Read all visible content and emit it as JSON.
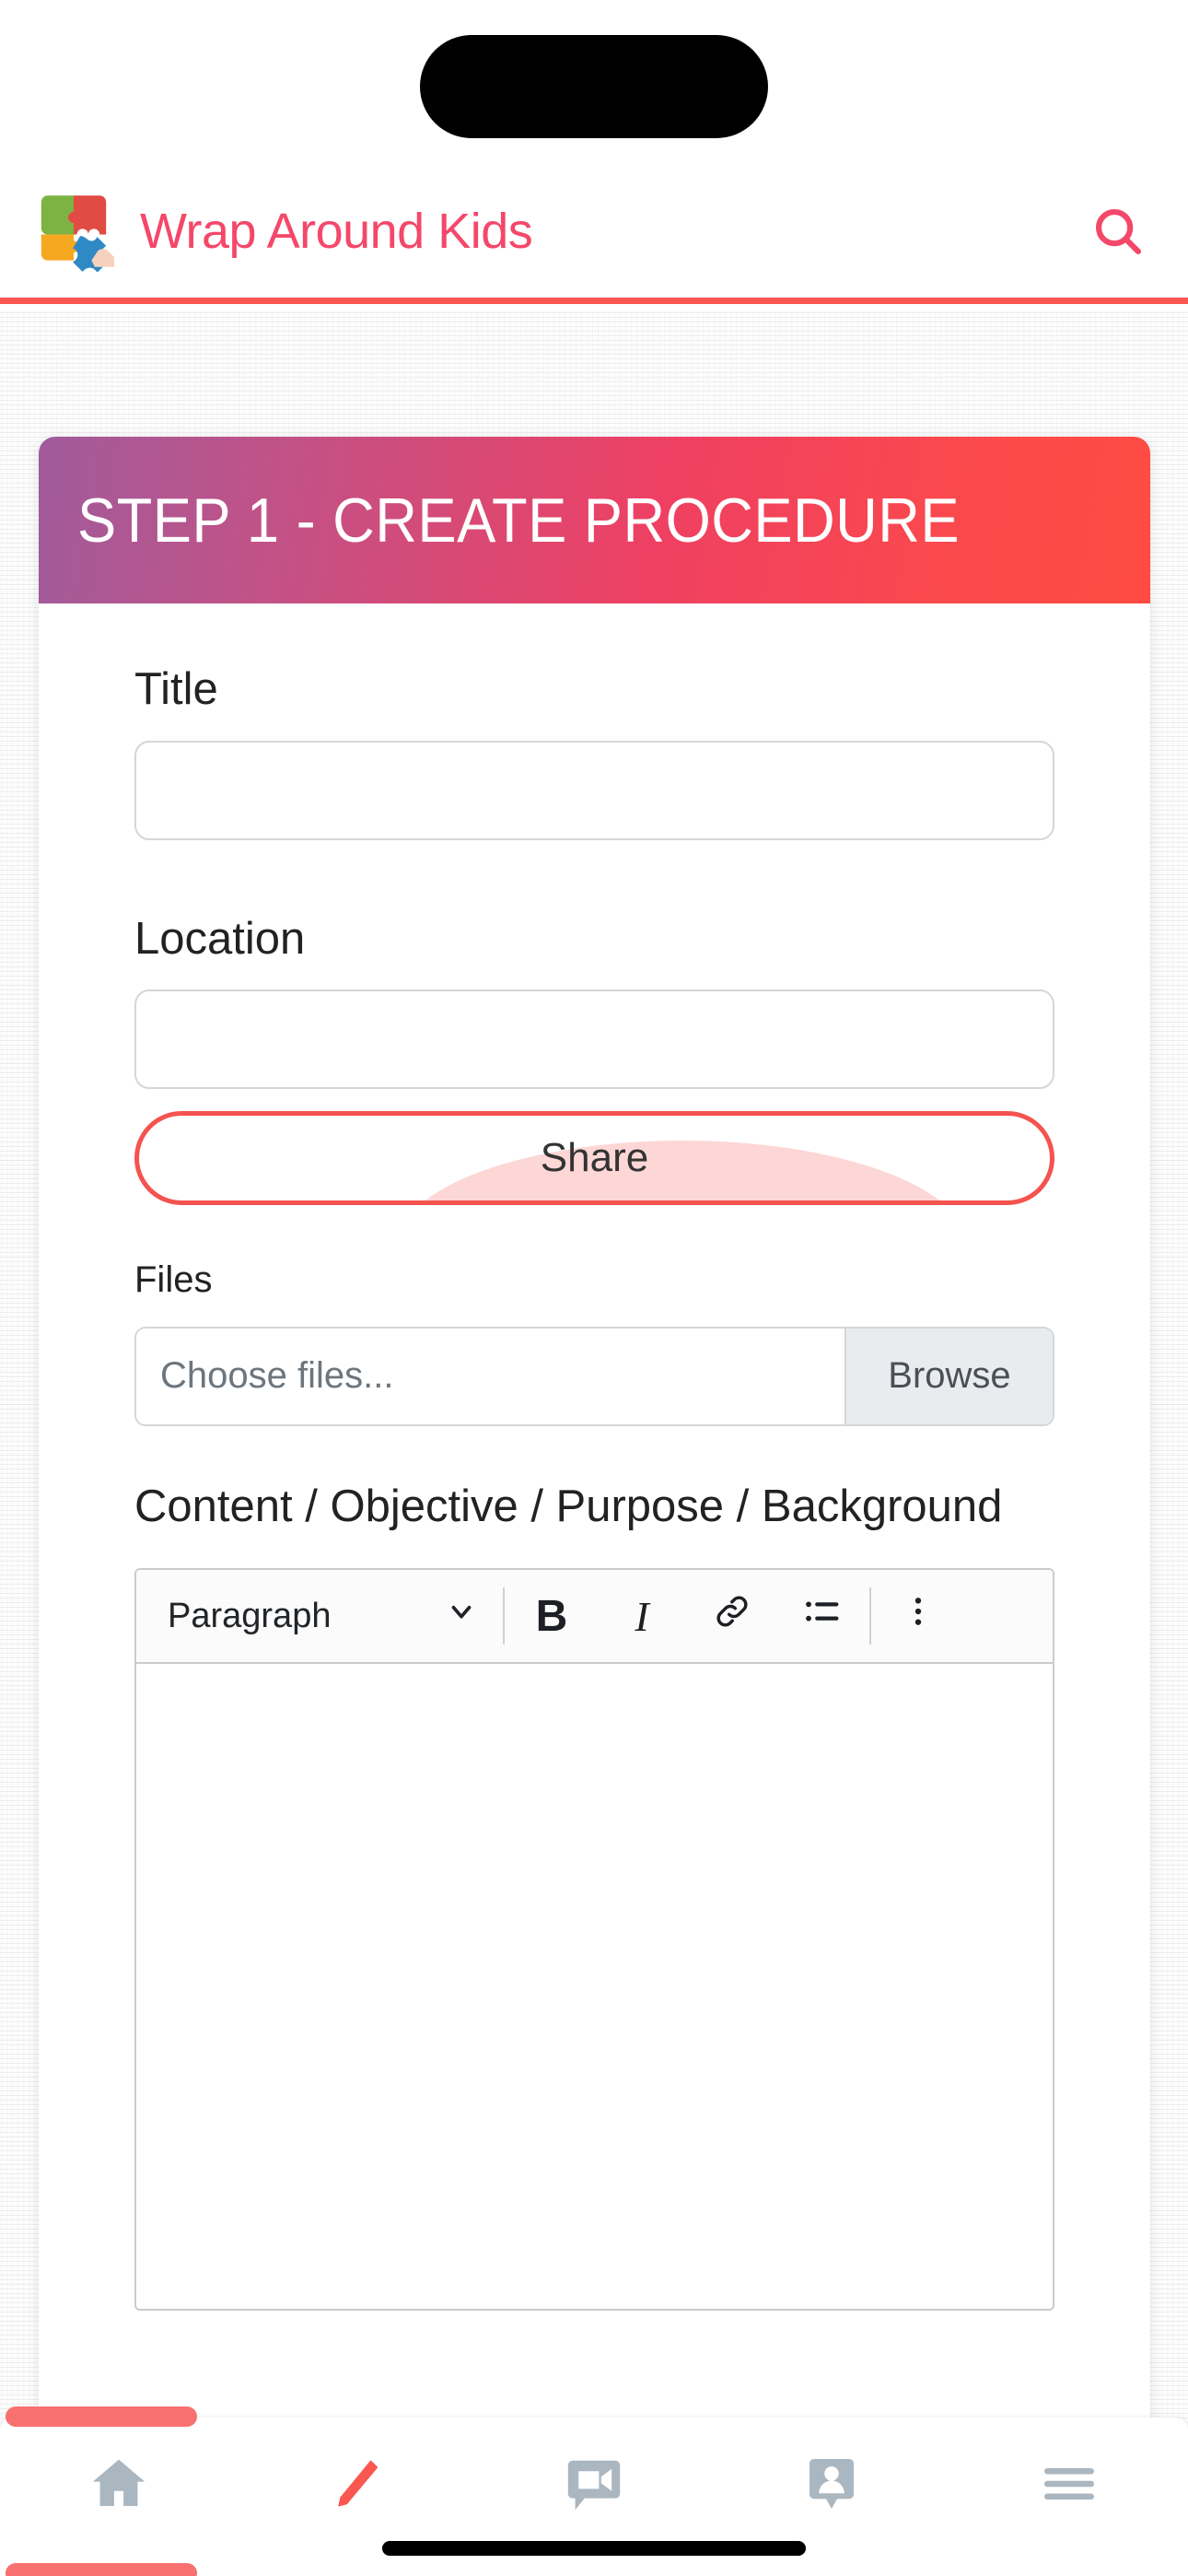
{
  "app": {
    "brand_title": "Wrap Around Kids",
    "brand_color": "#f4486a",
    "accent_color": "#f9574f",
    "logo_icon": "puzzle-hand-logo",
    "search_icon": "search-icon"
  },
  "card": {
    "header_title": "STEP 1 - CREATE PROCEDURE",
    "header_gradient_from": "#a05b9b",
    "header_gradient_to": "#ff4b42"
  },
  "form": {
    "title_label": "Title",
    "title_value": "",
    "title_placeholder": "",
    "location_label": "Location",
    "location_value": "",
    "location_placeholder": "",
    "share_label": "Share",
    "files_label": "Files",
    "files_placeholder": "Choose files...",
    "browse_label": "Browse",
    "content_label": "Content / Objective / Purpose / Background"
  },
  "editor": {
    "format_select_value": "Paragraph",
    "format_chevron_icon": "chevron-down-icon",
    "bold_label": "B",
    "bold_icon": "bold-icon",
    "italic_label": "I",
    "italic_icon": "italic-icon",
    "link_icon": "link-icon",
    "bullet_list_icon": "bullet-list-icon",
    "more_icon": "more-vertical-icon",
    "body_value": ""
  },
  "bottom_nav": {
    "items": [
      {
        "name": "home",
        "icon": "home-icon",
        "active": false
      },
      {
        "name": "edit",
        "icon": "pencil-icon",
        "active": true
      },
      {
        "name": "video-chat",
        "icon": "video-chat-icon",
        "active": false
      },
      {
        "name": "contacts",
        "icon": "contact-card-icon",
        "active": false
      },
      {
        "name": "menu",
        "icon": "hamburger-menu-icon",
        "active": false
      }
    ],
    "active_color": "#f9574f",
    "inactive_color": "#aab6c0"
  }
}
